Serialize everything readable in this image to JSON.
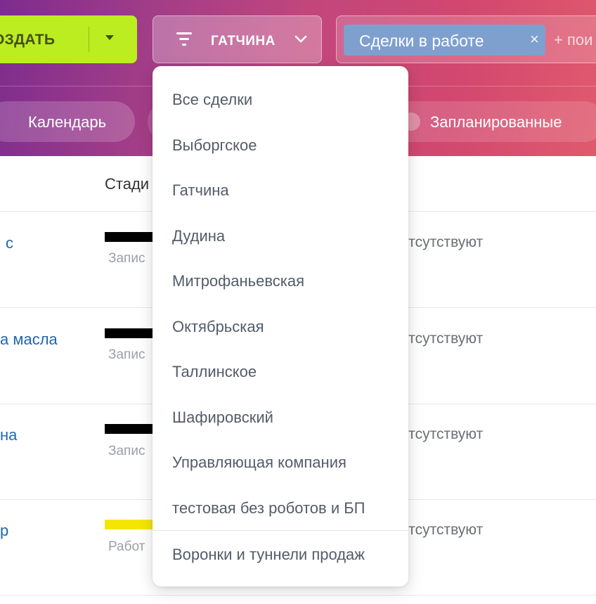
{
  "toolbar": {
    "create_label": "ОЗДАТЬ",
    "filter_label": "ГАТЧИНА",
    "search_chip": "Сделки в работе",
    "search_chip_close": "×",
    "search_placeholder": "+ пои"
  },
  "view_tabs": {
    "calendar": "Календарь",
    "planned": "Запланированные"
  },
  "table": {
    "stage_header": "Стади",
    "rows": [
      {
        "title": "с",
        "stage_color": "#000000",
        "stage_label": "Запис",
        "activity": "отсутствуют"
      },
      {
        "title": "а масла",
        "stage_color": "#000000",
        "stage_label": "Запис",
        "activity": "отсутствуют"
      },
      {
        "title": "на",
        "stage_color": "#000000",
        "stage_label": "Запис",
        "activity": "отсутствуют"
      },
      {
        "title": "р",
        "stage_color": "#f5e600",
        "stage_label": "Работ",
        "activity": "отсутствуют"
      }
    ]
  },
  "dropdown": {
    "items": [
      "Все сделки",
      "Выборгское",
      "Гатчина",
      "Дудина",
      "Митрофаньевская",
      "Октябрьская",
      "Таллинское",
      "Шафировский",
      "Управляющая компания",
      "тестовая без роботов и БП"
    ],
    "footer_item": "Воронки и туннели продаж"
  },
  "colors": {
    "create_button": "#bbed21",
    "chip": "#7ea0cf",
    "link": "#2067b0",
    "menu_text": "#535c69"
  }
}
